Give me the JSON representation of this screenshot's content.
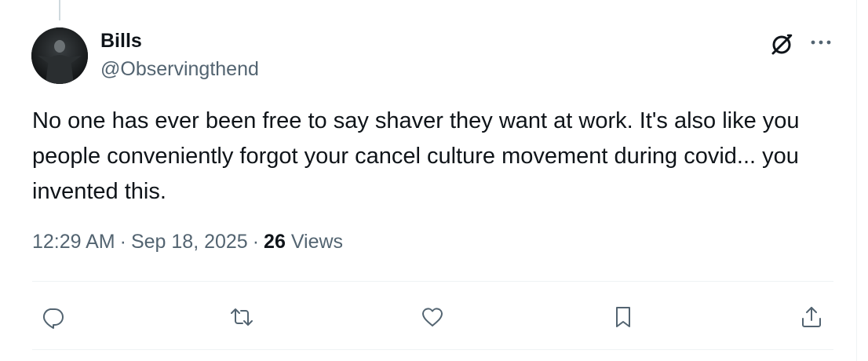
{
  "author": {
    "display_name": "Bills",
    "handle": "@Observingthend"
  },
  "tweet": {
    "text": "No one has ever been free to say shaver they want at work. It's also like you people conveniently forgot your cancel culture movement during covid... you invented this.",
    "time": "12:29 AM",
    "date": "Sep 18, 2025",
    "separator": "·",
    "views_count": "26",
    "views_label": "Views"
  },
  "icons": {
    "grok": "grok-icon",
    "more": "more-icon",
    "reply": "reply-icon",
    "repost": "repost-icon",
    "like": "like-icon",
    "bookmark": "bookmark-icon",
    "share": "share-icon"
  },
  "colors": {
    "text_primary": "#0f1419",
    "text_secondary": "#536471",
    "divider": "#eff3f4",
    "thread_line": "#cfd9de"
  }
}
